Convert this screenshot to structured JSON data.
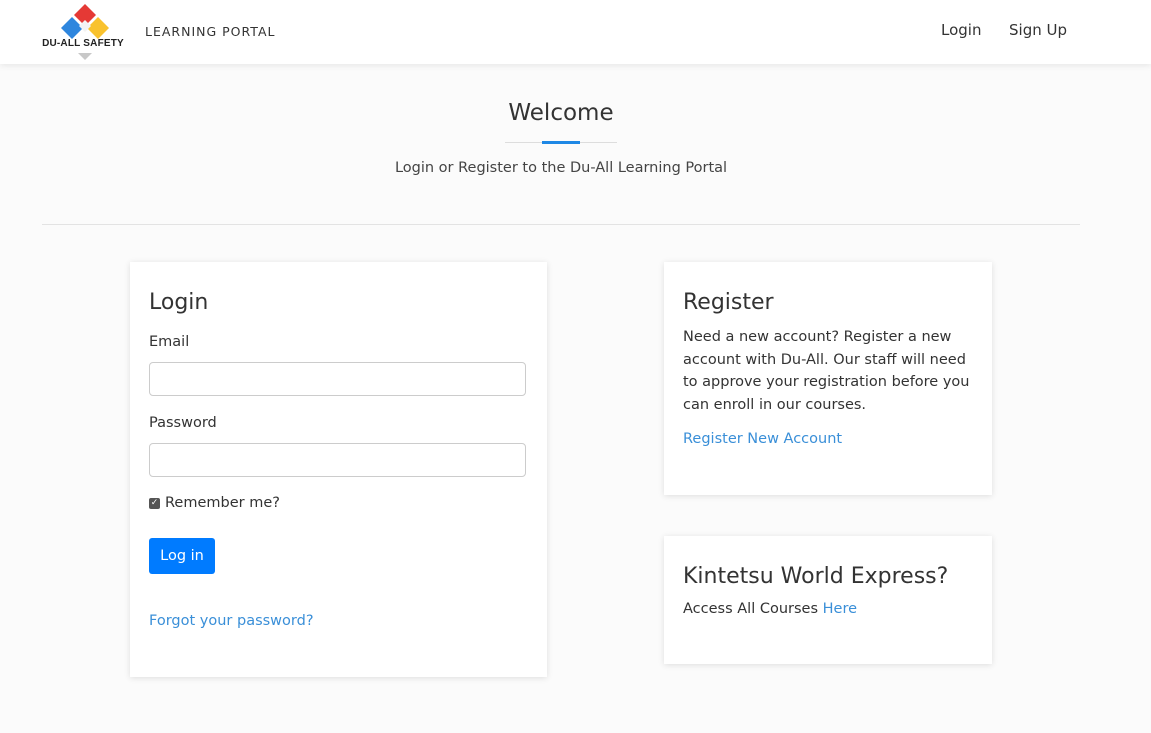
{
  "navbar": {
    "logo_text": "DU-ALL SAFETY",
    "brand": "LEARNING PORTAL",
    "links": {
      "login": "Login",
      "signup": "Sign Up"
    }
  },
  "hero": {
    "title": "Welcome",
    "subtitle": "Login or Register to the Du-All Learning Portal"
  },
  "login_card": {
    "title": "Login",
    "email_label": "Email",
    "email_value": "",
    "password_label": "Password",
    "password_value": "",
    "remember_label": "Remember me?",
    "remember_checked": true,
    "submit_label": "Log in",
    "forgot_link": "Forgot your password?"
  },
  "register_card": {
    "title": "Register",
    "description": "Need a new account? Register a new account with Du-All. Our staff will need to approve your registration before you can enroll in our courses.",
    "link": "Register New Account"
  },
  "kwe_card": {
    "title": "Kintetsu World Express?",
    "text": "Access All Courses",
    "link": "Here"
  },
  "colors": {
    "primary_button": "#007bff",
    "link": "#3a8fd8",
    "accent": "#1e88e5",
    "logo_red": "#e53935",
    "logo_blue": "#2e86de",
    "logo_yellow": "#f9c22e"
  }
}
